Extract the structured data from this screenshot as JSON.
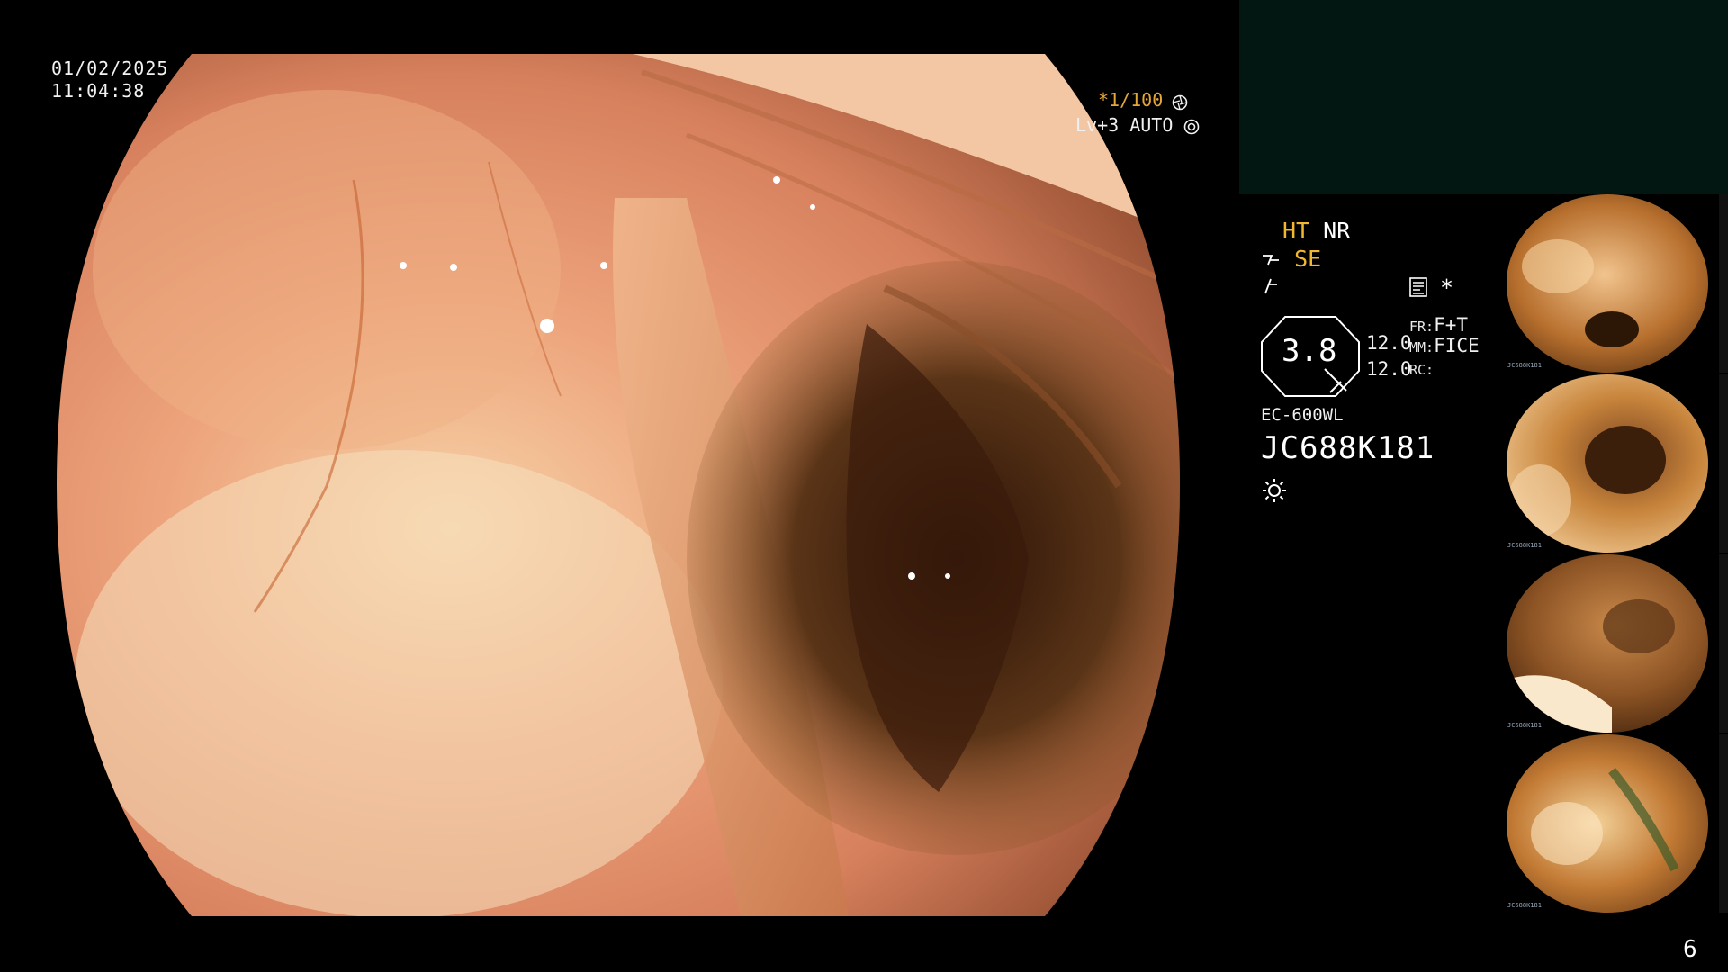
{
  "datetime": {
    "date": "01/02/2025",
    "time": "11:04:38"
  },
  "shutter": {
    "value": "*1/100",
    "icon": "shutter-icon"
  },
  "brightness": {
    "level": "Lv+3",
    "mode": "AUTO",
    "icon": "iris-icon"
  },
  "modes": {
    "ht": "HT",
    "nr": "NR",
    "se": "SE",
    "se_icon": "structure-enhance-icon",
    "wave_icon": "wave-icon",
    "memo_icon": "memo-icon",
    "star": "*"
  },
  "zoom": {
    "value": "3.8"
  },
  "settings": {
    "row1_value": "12.0",
    "row2_value": "12.0",
    "fr_label": "FR:",
    "fr_value": "F+T",
    "mm_label": "MM:",
    "mm_value": "FICE",
    "rc_label": "RC:"
  },
  "scope_model": "EC-600WL",
  "serial": "JC688K181",
  "light_icon": "light-icon",
  "colors": {
    "panel": "#021612",
    "accent": "#f1b730"
  },
  "thumbnails": [
    {
      "caption": "JC688K181"
    },
    {
      "caption": "JC688K181"
    },
    {
      "caption": "JC688K181"
    },
    {
      "caption": "JC688K181"
    }
  ],
  "page_number": "6"
}
